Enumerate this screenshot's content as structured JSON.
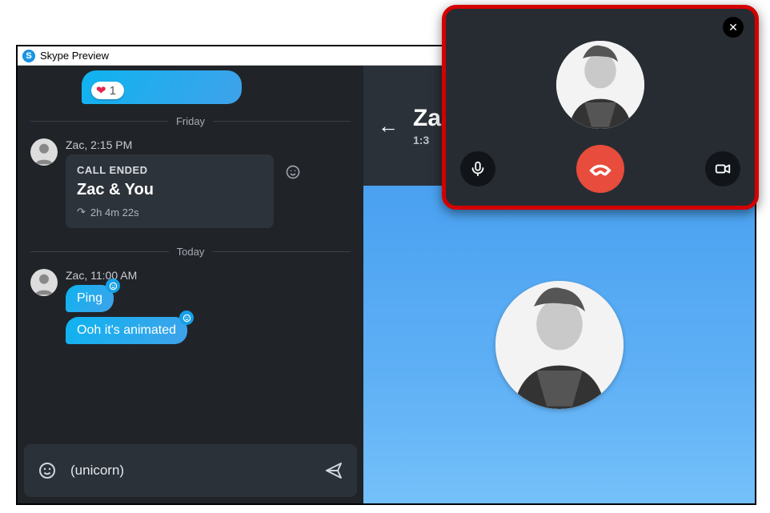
{
  "window": {
    "title": "Skype Preview",
    "logo_letter": "S"
  },
  "chat": {
    "reaction": {
      "emoji": "❤",
      "count": "1"
    },
    "dividers": {
      "d1": "Friday",
      "d2": "Today"
    },
    "call_card": {
      "sender_meta": "Zac, 2:15 PM",
      "header": "CALL ENDED",
      "title": "Zac & You",
      "duration_icon": "↷",
      "duration": "2h 4m 22s"
    },
    "msgs": {
      "meta": "Zac, 11:00 AM",
      "m1": "Ping",
      "m2": "Ooh it's animated"
    }
  },
  "composer": {
    "text": "(unicorn)"
  },
  "conv": {
    "title_visible": "Za",
    "subtitle_visible": "1:3"
  },
  "call_overlay": {
    "close": "✕"
  },
  "icons": {
    "smiley": "☺",
    "send": "➤",
    "back": "←",
    "mic": "mic",
    "video": "video",
    "hangup": "hangup"
  }
}
